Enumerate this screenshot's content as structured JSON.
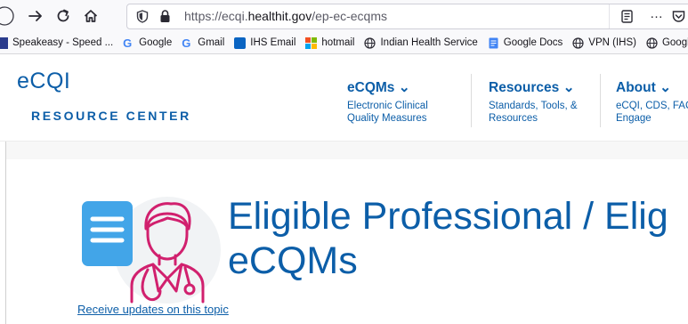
{
  "browser": {
    "url_prefix": "https://ecqi.",
    "url_domain": "healthit.gov",
    "url_path": "/ep-ec-ecqms",
    "overflow_menu": "…",
    "bookmarks": [
      {
        "label": "Speakeasy - Speed ...",
        "icon": "speakeasy-icon"
      },
      {
        "label": "Google",
        "icon": "google-icon"
      },
      {
        "label": "Gmail",
        "icon": "gmail-icon"
      },
      {
        "label": "IHS Email",
        "icon": "outlook-icon"
      },
      {
        "label": "hotmail",
        "icon": "windows-icon"
      },
      {
        "label": "Indian Health Service",
        "icon": "globe-icon"
      },
      {
        "label": "Google Docs",
        "icon": "docs-icon"
      },
      {
        "label": "VPN (IHS)",
        "icon": "globe-icon"
      },
      {
        "label": "Google Map",
        "icon": "globe-icon"
      }
    ]
  },
  "header": {
    "brand_top": "eCQI",
    "brand_bottom": "RESOURCE CENTER",
    "nav": [
      {
        "title": "eCQMs ⌄",
        "sub1": "Electronic Clinical",
        "sub2": "Quality Measures"
      },
      {
        "title": "Resources ⌄",
        "sub1": "Standards, Tools, &",
        "sub2": "Resources"
      },
      {
        "title": "About ⌄",
        "sub1": "eCQI, CDS, FAC",
        "sub2": "Engage"
      }
    ]
  },
  "main": {
    "title_line1": "Eligible Professional / Elig",
    "title_line2": "eCQMs",
    "receive_link": "Receive updates on this topic"
  },
  "colors": {
    "brand_blue": "#0c5ea8",
    "icon_blue": "#42a5e8",
    "icon_magenta": "#d1206e"
  }
}
